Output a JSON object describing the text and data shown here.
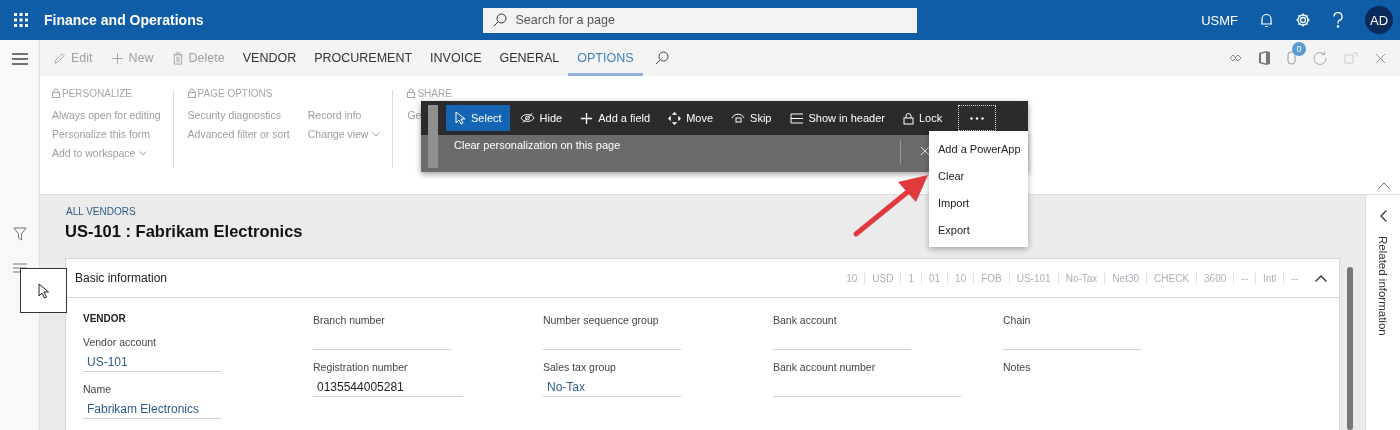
{
  "app": {
    "title": "Finance and Operations",
    "search": {
      "placeholder": "Search for a page"
    },
    "company": "USMF",
    "avatar": "AD"
  },
  "action_pane": {
    "buttons": [
      {
        "kind": "edit",
        "label": "Edit",
        "disabled": true
      },
      {
        "kind": "new",
        "label": "New",
        "disabled": true
      },
      {
        "kind": "delete",
        "label": "Delete",
        "disabled": true
      }
    ],
    "tabs": [
      {
        "label": "VENDOR",
        "selected": false
      },
      {
        "label": "PROCUREMENT",
        "selected": false
      },
      {
        "label": "INVOICE",
        "selected": false
      },
      {
        "label": "GENERAL",
        "selected": false
      },
      {
        "label": "OPTIONS",
        "selected": true
      }
    ],
    "attachments_count": "0"
  },
  "ribbon": {
    "groups": [
      {
        "title": "PERSONALIZE",
        "columns": [
          [
            {
              "label": "Always open for editing",
              "disabled": true,
              "dropdown": false
            },
            {
              "label": "Personalize this form",
              "disabled": true,
              "dropdown": false
            },
            {
              "label": "Add to workspace",
              "disabled": true,
              "dropdown": true
            }
          ]
        ]
      },
      {
        "title": "PAGE OPTIONS",
        "columns": [
          [
            {
              "label": "Security diagnostics",
              "disabled": true,
              "dropdown": false
            },
            {
              "label": "Advanced filter or sort",
              "disabled": true,
              "dropdown": false
            }
          ],
          [
            {
              "label": "Record info",
              "disabled": true,
              "dropdown": false
            },
            {
              "label": "Change view",
              "disabled": true,
              "dropdown": true
            }
          ]
        ]
      },
      {
        "title": "SHARE",
        "columns": [
          [
            {
              "label": "Ge",
              "disabled": true,
              "dropdown": false
            }
          ]
        ]
      }
    ]
  },
  "personalization_toolbar": {
    "tools": [
      {
        "kind": "select",
        "label": "Select",
        "selected": true
      },
      {
        "kind": "hide",
        "label": "Hide",
        "selected": false
      },
      {
        "kind": "add",
        "label": "Add a field",
        "selected": false
      },
      {
        "kind": "move",
        "label": "Move",
        "selected": false
      },
      {
        "kind": "skip",
        "label": "Skip",
        "selected": false
      },
      {
        "kind": "header",
        "label": "Show in header",
        "selected": false
      },
      {
        "kind": "lock",
        "label": "Lock",
        "selected": false
      }
    ],
    "more_selected": true,
    "message": "Clear personalization on this page",
    "menu": [
      "Add a PowerApp",
      "Clear",
      "Import",
      "Export"
    ]
  },
  "page": {
    "breadcrumb": "ALL VENDORS",
    "title": "US-101 : Fabrikam Electronics",
    "fasttab": {
      "title": "Basic information",
      "expanded": true,
      "summary": [
        "10",
        "USD",
        "1",
        "01",
        "10",
        "FOB",
        "US-101",
        "No-Tax",
        "Net30",
        "CHECK",
        "3600",
        "--",
        "Intl",
        "--"
      ],
      "columns": [
        [
          {
            "kind": "heading",
            "label": "VENDOR"
          },
          {
            "kind": "field",
            "label": "Vendor account",
            "value": "US-101",
            "link": true
          },
          {
            "kind": "field",
            "label": "Name",
            "value": "Fabrikam Electronics",
            "link": true
          }
        ],
        [
          {
            "kind": "field",
            "label": "Branch number"
          },
          {
            "kind": "field",
            "label": "Registration number",
            "value": "0135544005281",
            "link": false
          }
        ],
        [
          {
            "kind": "field",
            "label": "Number sequence group"
          },
          {
            "kind": "field",
            "label": "Sales tax group",
            "value": "No-Tax",
            "link": true
          }
        ],
        [
          {
            "kind": "field",
            "label": "Bank account"
          },
          {
            "kind": "field",
            "label": "Bank account number"
          }
        ],
        [
          {
            "kind": "field",
            "label": "Chain"
          },
          {
            "kind": "note",
            "label": "Notes"
          }
        ]
      ]
    }
  },
  "related_pane": {
    "title": "Related information"
  }
}
